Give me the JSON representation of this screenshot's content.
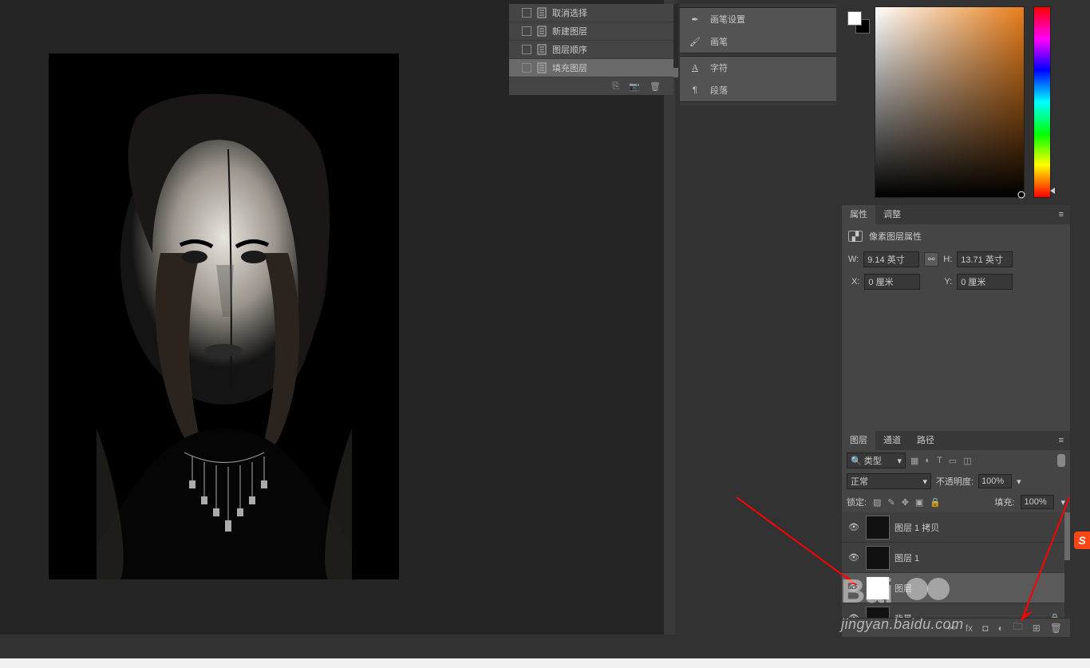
{
  "history": {
    "items": [
      {
        "label": "取消选择"
      },
      {
        "label": "新建图层"
      },
      {
        "label": "图层顺序"
      },
      {
        "label": "填充图层"
      }
    ],
    "active_index": 3
  },
  "mid_panel": {
    "items": [
      {
        "icon": "brush-settings-icon",
        "label": "画笔设置"
      },
      {
        "icon": "brush-icon",
        "label": "画笔"
      },
      {
        "icon": "character-icon",
        "label": "字符"
      },
      {
        "icon": "paragraph-icon",
        "label": "段落"
      }
    ]
  },
  "properties": {
    "tabs": [
      "属性",
      "调整"
    ],
    "title": "像素图层属性",
    "w_label": "W:",
    "w_value": "9.14 英寸",
    "h_label": "H:",
    "h_value": "13.71 英寸",
    "x_label": "X:",
    "x_value": "0 厘米",
    "y_label": "Y:",
    "y_value": "0 厘米"
  },
  "layers_panel": {
    "tabs": [
      "图层",
      "通道",
      "路径"
    ],
    "type_label": "类型",
    "blend_mode": "正常",
    "opacity_label": "不透明度:",
    "opacity_value": "100%",
    "lock_label": "锁定:",
    "fill_label": "填充:",
    "fill_value": "100%",
    "layers": [
      {
        "name": "图层 1 拷贝",
        "thumb": "dark"
      },
      {
        "name": "图层 1",
        "thumb": "dark"
      },
      {
        "name": "图层",
        "thumb": "white"
      },
      {
        "name": "背景",
        "thumb": "dark",
        "locked": true
      }
    ]
  },
  "watermark": "jingyan.baidu.com",
  "sogou": "S"
}
